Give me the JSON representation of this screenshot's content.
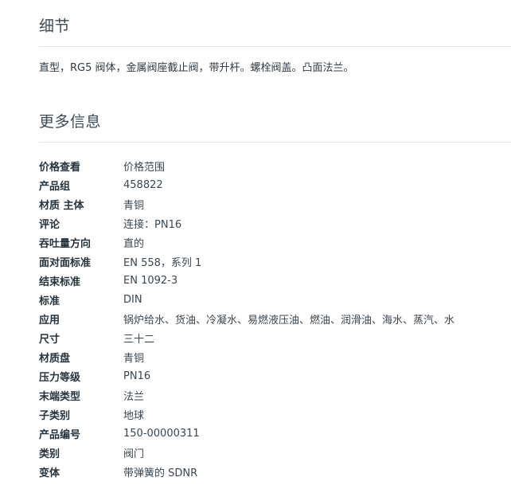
{
  "details": {
    "title": "细节",
    "description": "直型，RG5 阀体，金属阀座截止阀，带升杆。螺栓阀盖。凸面法兰。"
  },
  "more_info": {
    "title": "更多信息",
    "rows": [
      {
        "label": "价格查看",
        "value": "价格范围"
      },
      {
        "label": "产品组",
        "value": "458822"
      },
      {
        "label": "材质 主体",
        "value": "青铜"
      },
      {
        "label": "评论",
        "value": "连接：PN16"
      },
      {
        "label": "吞吐量方向",
        "value": "直的"
      },
      {
        "label": "面对面标准",
        "value": "EN 558，系列 1"
      },
      {
        "label": "结束标准",
        "value": "EN 1092-3"
      },
      {
        "label": "标准",
        "value": "DIN"
      },
      {
        "label": "应用",
        "value": "锅炉给水、货油、冷凝水、易燃液压油、燃油、润滑油、海水、蒸汽、水"
      },
      {
        "label": "尺寸",
        "value": "三十二"
      },
      {
        "label": "材质盘",
        "value": "青铜"
      },
      {
        "label": "压力等级",
        "value": "PN16"
      },
      {
        "label": "末端类型",
        "value": "法兰"
      },
      {
        "label": "子类别",
        "value": "地球"
      },
      {
        "label": "产品编号",
        "value": "150-00000311"
      },
      {
        "label": "类别",
        "value": "阀门"
      },
      {
        "label": "变体",
        "value": "带弹簧的 SDNR"
      }
    ]
  }
}
